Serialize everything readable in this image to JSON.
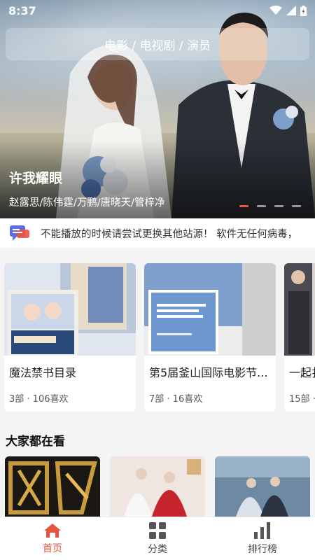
{
  "status_bar": {
    "time": "8:37"
  },
  "search": {
    "placeholder": "电影 / 电视剧 / 演员"
  },
  "hero": {
    "title": "许我耀眼",
    "cast": "赵露思/陈伟霆/万鹏/唐晓天/管梓净",
    "slide_count": 4,
    "active_slide": 1
  },
  "notice": {
    "icon": "chat-bubble-icon",
    "text": "不能播放的时候请尝试更换其他站源！ 软件无任何病毒，"
  },
  "collections": [
    {
      "title": "魔法禁书目录",
      "meta": "3部 · 106喜欢"
    },
    {
      "title": "第5届釜山国际电影节...",
      "meta": "7部 · 16喜欢"
    },
    {
      "title": "一起扌",
      "meta": "15部 ·"
    }
  ],
  "trending": {
    "title": "大家都在看"
  },
  "bottom_nav": {
    "items": [
      {
        "label": "首页",
        "icon": "home-icon",
        "active": true
      },
      {
        "label": "分类",
        "icon": "grid-icon",
        "active": false
      },
      {
        "label": "排行榜",
        "icon": "bar-chart-icon",
        "active": false
      }
    ]
  },
  "colors": {
    "accent": "#e8533d",
    "notice_icon": "#5b6ee8"
  }
}
